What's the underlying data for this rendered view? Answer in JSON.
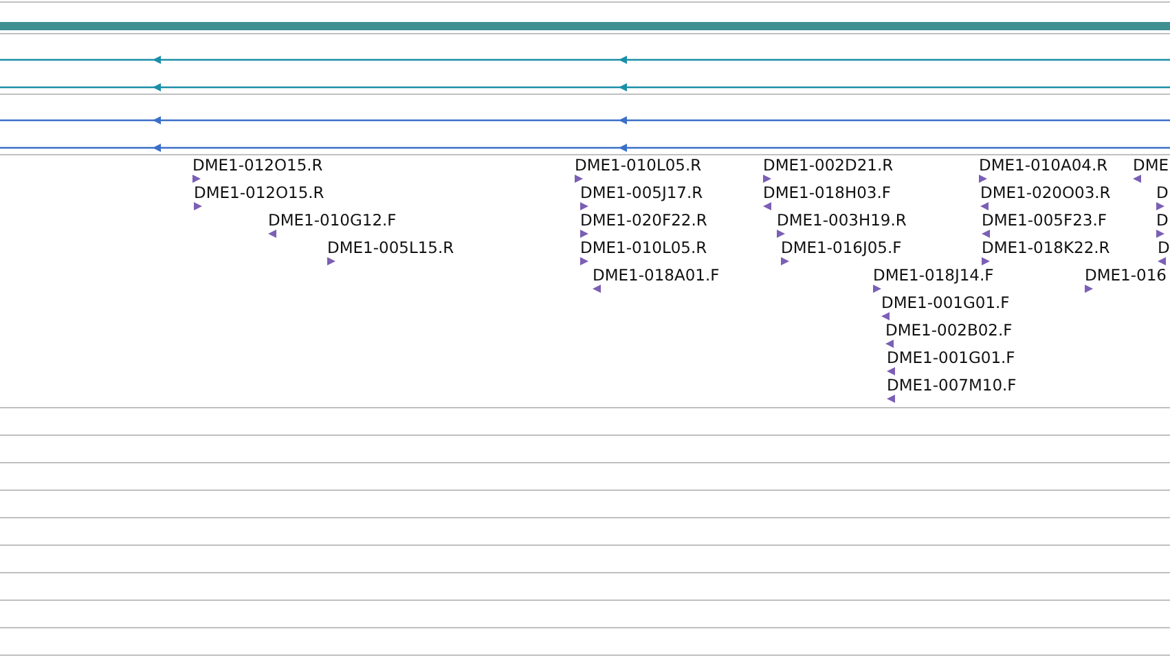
{
  "transcripts": [
    {
      "color": "#1a8fa8",
      "forward": false
    },
    {
      "color": "#1a8fa8",
      "forward": false
    },
    {
      "color": "#3a6fc8",
      "forward": false
    },
    {
      "color": "#3a6fc8",
      "forward": false
    }
  ],
  "reads": [
    {
      "label": "DME1-012O15.R",
      "forward": true
    },
    {
      "label": "DME1-010L05.R",
      "forward": true
    },
    {
      "label": "DME1-002D21.R",
      "forward": true
    },
    {
      "label": "DME1-010A04.R",
      "forward": true
    },
    {
      "label": "DME",
      "forward": false
    },
    {
      "label": "DME1-012O15.R",
      "forward": true
    },
    {
      "label": "DME1-005J17.R",
      "forward": true
    },
    {
      "label": "DME1-018H03.F",
      "forward": false
    },
    {
      "label": "DME1-020O03.R",
      "forward": false
    },
    {
      "label": "D",
      "forward": true
    },
    {
      "label": "DME1-010G12.F",
      "forward": false
    },
    {
      "label": "DME1-020F22.R",
      "forward": true
    },
    {
      "label": "DME1-003H19.R",
      "forward": true
    },
    {
      "label": "DME1-005F23.F",
      "forward": false
    },
    {
      "label": "D",
      "forward": true
    },
    {
      "label": "DME1-005L15.R",
      "forward": true
    },
    {
      "label": "DME1-010L05.R",
      "forward": true
    },
    {
      "label": "DME1-016J05.F",
      "forward": true
    },
    {
      "label": "DME1-018K22.R",
      "forward": true
    },
    {
      "label": "D",
      "forward": false
    },
    {
      "label": "DME1-018A01.F",
      "forward": false
    },
    {
      "label": "DME1-018J14.F",
      "forward": true
    },
    {
      "label": "DME1-016",
      "forward": true
    },
    {
      "label": "DME1-001G01.F",
      "forward": false
    },
    {
      "label": "DME1-002B02.F",
      "forward": false
    },
    {
      "label": "DME1-001G01.F",
      "forward": false
    },
    {
      "label": "DME1-007M10.F",
      "forward": false
    }
  ]
}
